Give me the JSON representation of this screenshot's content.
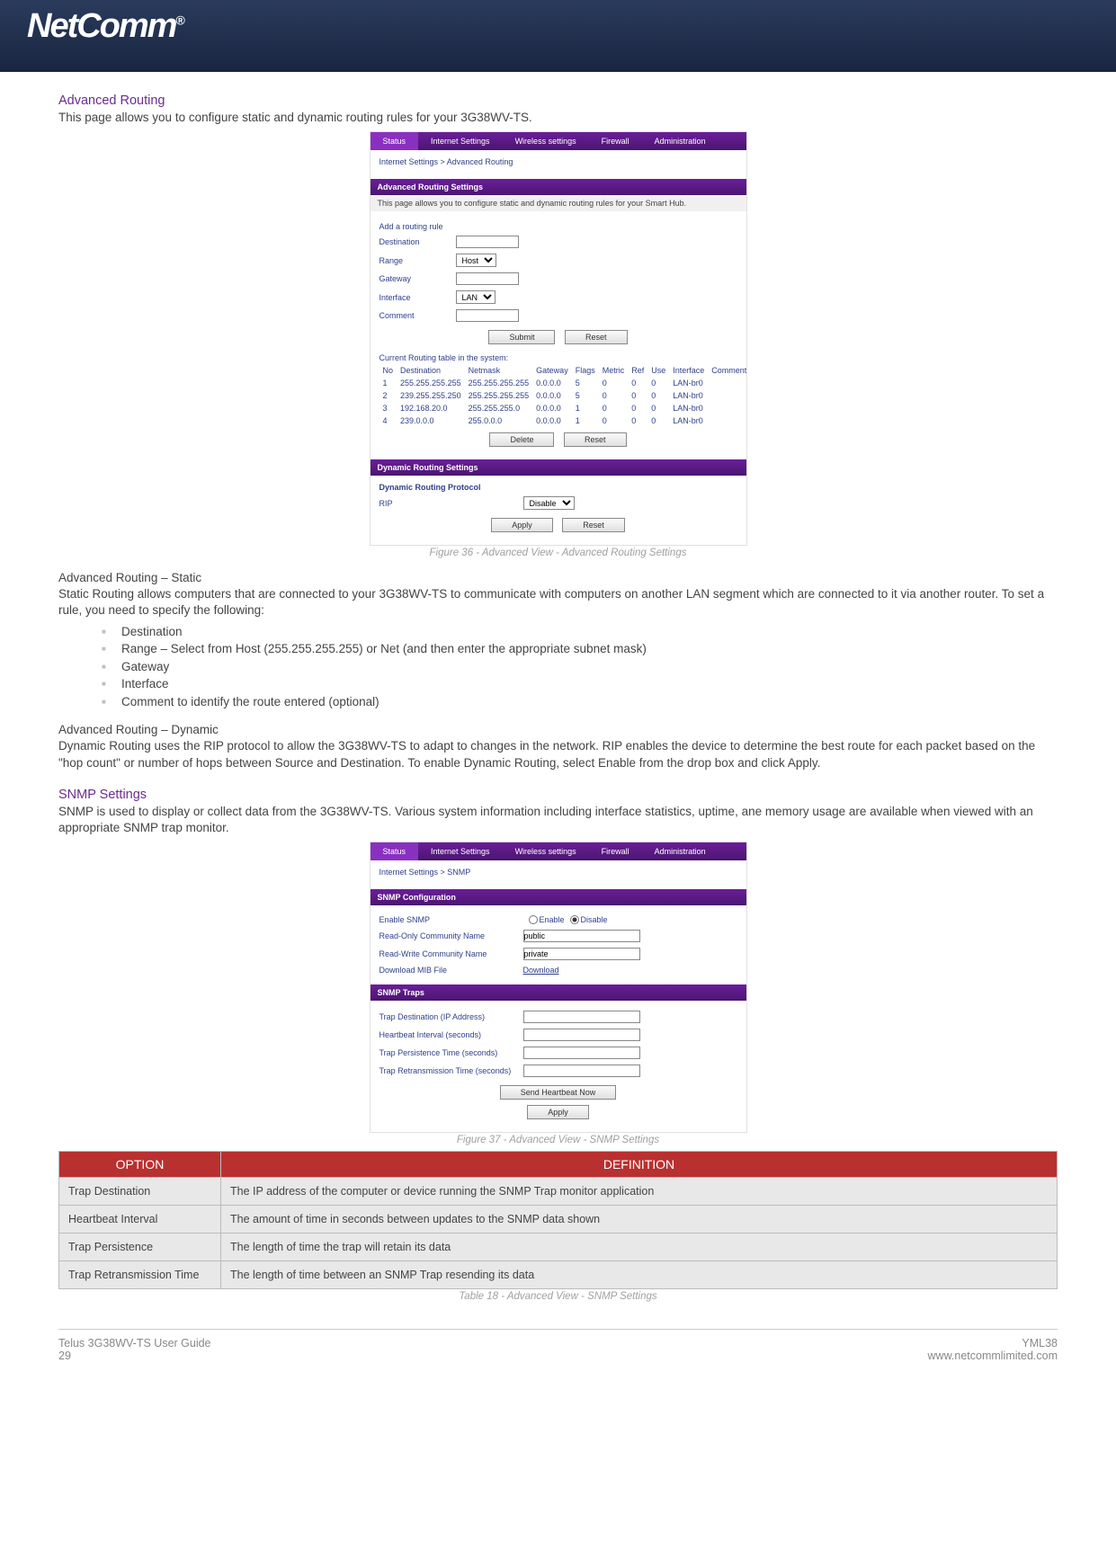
{
  "brand": "NetComm",
  "sections": {
    "adv_routing_title": "Advanced Routing",
    "adv_routing_intro": "This page allows you to configure static and dynamic routing rules for your 3G38WV-TS.",
    "fig36_caption": "Figure 36 - Advanced View - Advanced Routing Settings",
    "adv_routing_static_title": "Advanced Routing – Static",
    "adv_routing_static_p": "Static Routing allows computers that are connected to your 3G38WV-TS to communicate with computers on another LAN segment which are connected to it via another router. To set a rule, you need to specify the following:",
    "adv_routing_static_bullets": [
      "Destination",
      "Range – Select from Host (255.255.255.255) or Net (and then enter the appropriate subnet mask)",
      "Gateway",
      "Interface",
      "Comment to identify the route entered (optional)"
    ],
    "adv_routing_dynamic_title": "Advanced Routing – Dynamic",
    "adv_routing_dynamic_p": "Dynamic Routing uses the RIP protocol to allow the 3G38WV-TS to adapt to changes in the network. RIP enables the device to determine the best route for each packet based on the \"hop count\" or number of hops between Source and Destination. To enable Dynamic Routing, select Enable from the drop box and click Apply.",
    "snmp_title": "SNMP Settings",
    "snmp_p": "SNMP is used to display or collect data from the 3G38WV-TS. Various system information including interface statistics, uptime, ane memory usage are available when viewed with an appropriate SNMP trap monitor.",
    "fig37_caption": "Figure 37 - Advanced View - SNMP Settings",
    "table18_caption": "Table 18 - Advanced View - SNMP Settings"
  },
  "routing_screenshot": {
    "nav": [
      "Status",
      "Internet Settings",
      "Wireless settings",
      "Firewall",
      "Administration"
    ],
    "breadcrumb": "Internet Settings > Advanced Routing",
    "bar1": "Advanced Routing Settings",
    "desc": "This page allows you to configure static and dynamic routing rules for your Smart Hub.",
    "add_rule": "Add a routing rule",
    "labels": {
      "destination": "Destination",
      "range": "Range",
      "gateway": "Gateway",
      "interface": "Interface",
      "comment": "Comment"
    },
    "range_value": "Host",
    "interface_value": "LAN",
    "btn_submit": "Submit",
    "btn_reset": "Reset",
    "btn_delete": "Delete",
    "btn_apply": "Apply",
    "current_caption": "Current Routing table in the system:",
    "cols": [
      "No",
      "Destination",
      "Netmask",
      "Gateway",
      "Flags",
      "Metric",
      "Ref",
      "Use",
      "Interface",
      "Comment"
    ],
    "rows": [
      [
        "1",
        "255.255.255.255",
        "255.255.255.255",
        "0.0.0.0",
        "5",
        "0",
        "0",
        "0",
        "LAN-br0",
        ""
      ],
      [
        "2",
        "239.255.255.250",
        "255.255.255.255",
        "0.0.0.0",
        "5",
        "0",
        "0",
        "0",
        "LAN-br0",
        ""
      ],
      [
        "3",
        "192.168.20.0",
        "255.255.255.0",
        "0.0.0.0",
        "1",
        "0",
        "0",
        "0",
        "LAN-br0",
        ""
      ],
      [
        "4",
        "239.0.0.0",
        "255.0.0.0",
        "0.0.0.0",
        "1",
        "0",
        "0",
        "0",
        "LAN-br0",
        ""
      ]
    ],
    "bar2": "Dynamic Routing Settings",
    "dyn_proto_label": "Dynamic Routing Protocol",
    "rip_label": "RIP",
    "rip_value": "Disable"
  },
  "snmp_screenshot": {
    "nav": [
      "Status",
      "Internet Settings",
      "Wireless settings",
      "Firewall",
      "Administration"
    ],
    "breadcrumb": "Internet Settings > SNMP",
    "bar1": "SNMP Configuration",
    "rows1": {
      "enable_label": "Enable SNMP",
      "enable_opt_en": "Enable",
      "enable_opt_dis": "Disable",
      "ro_label": "Read-Only Community Name",
      "ro_value": "public",
      "rw_label": "Read-Write Community Name",
      "rw_value": "private",
      "mib_label": "Download MIB File",
      "mib_link": "Download"
    },
    "bar2": "SNMP Traps",
    "rows2": {
      "trap_dest": "Trap Destination (IP Address)",
      "hb_int": "Heartbeat Interval (seconds)",
      "trap_pers": "Trap Persistence Time (seconds)",
      "trap_retr": "Trap Retransmission Time (seconds)"
    },
    "btn_hb": "Send Heartbeat Now",
    "btn_apply": "Apply"
  },
  "def_table": {
    "head_option": "OPTION",
    "head_definition": "DEFINITION",
    "rows": [
      {
        "o": "Trap Destination",
        "d": "The IP address of the computer or device running the SNMP Trap monitor application"
      },
      {
        "o": "Heartbeat Interval",
        "d": "The amount of time in seconds between updates to the SNMP data shown"
      },
      {
        "o": "Trap Persistence",
        "d": "The length of time the trap will retain its data"
      },
      {
        "o": "Trap Retransmission Time",
        "d": "The length of time between an SNMP Trap resending its data"
      }
    ]
  },
  "footer": {
    "left1": "Telus 3G38WV-TS User Guide",
    "left2": "29",
    "right1": "YML38",
    "right2": "www.netcommlimited.com"
  }
}
